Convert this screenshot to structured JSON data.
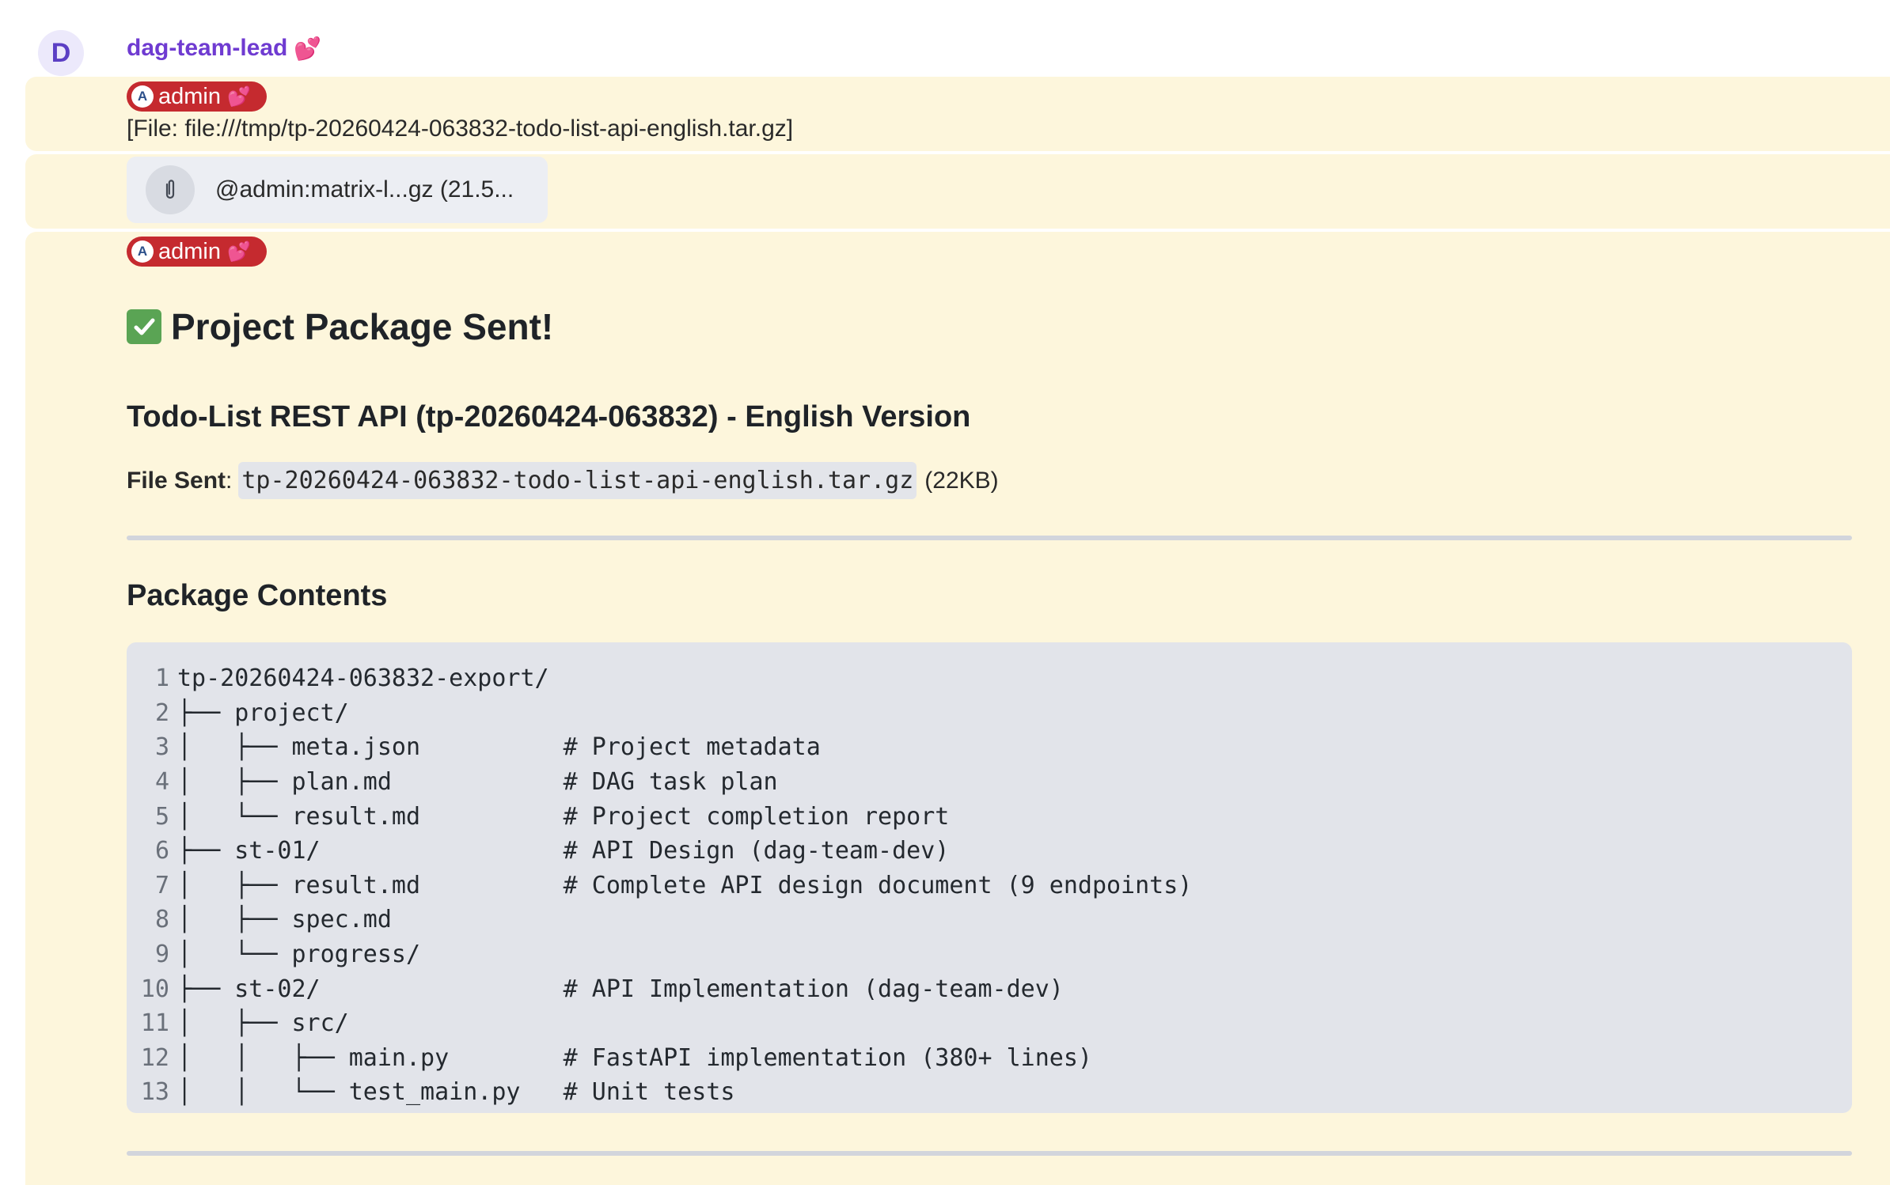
{
  "sender": {
    "avatar_letter": "D",
    "name": "dag-team-lead",
    "emoji": "💕"
  },
  "messages": [
    {
      "user_pill": {
        "avatar_letter": "A",
        "name": "admin",
        "emoji": "💕"
      },
      "text": "[File: file:///tmp/tp-20260424-063832-todo-list-api-english.tar.gz]"
    },
    {
      "attachment": {
        "icon": "paperclip-icon",
        "name": "@admin:matrix-l...gz (21.5..."
      }
    },
    {
      "user_pill": {
        "avatar_letter": "A",
        "name": "admin",
        "emoji": "💕"
      },
      "heading": {
        "emoji": "✅",
        "text": "Project Package Sent!"
      },
      "subheading": "Todo-List REST API (tp-20260424-063832) - English Version",
      "file_sent": {
        "label": "File Sent",
        "filename": "tp-20260424-063832-todo-list-api-english.tar.gz",
        "size": "(22KB)"
      },
      "section_title": "Package Contents",
      "code_lines": [
        "tp-20260424-063832-export/",
        "├── project/",
        "│   ├── meta.json          # Project metadata",
        "│   ├── plan.md            # DAG task plan",
        "│   └── result.md          # Project completion report",
        "├── st-01/                 # API Design (dag-team-dev)",
        "│   ├── result.md          # Complete API design document (9 endpoints)",
        "│   ├── spec.md",
        "│   └── progress/",
        "├── st-02/                 # API Implementation (dag-team-dev)",
        "│   ├── src/",
        "│   │   ├── main.py        # FastAPI implementation (380+ lines)",
        "│   │   └── test_main.py   # Unit tests"
      ]
    }
  ],
  "colors": {
    "sender_name": "#6f3bd1",
    "pill_bg": "#c52a2f",
    "highlight_bg": "#fdf6dc",
    "code_bg": "#e2e4ea"
  }
}
